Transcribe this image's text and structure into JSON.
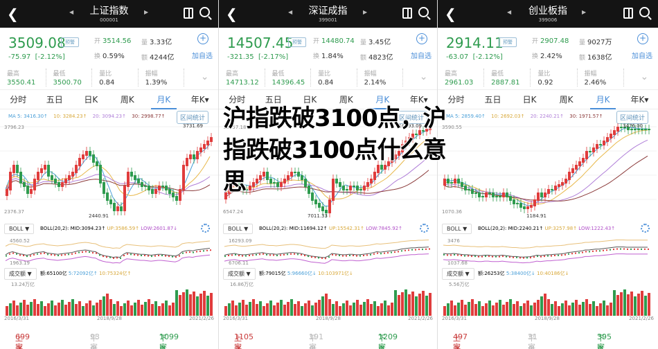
{
  "overlay_title": "沪指跌破3100点，沪指跌破3100点什么意思",
  "common": {
    "warn_label": "预警",
    "add_label": "加自选",
    "tabs": [
      "分时",
      "五日",
      "日K",
      "周K",
      "月K",
      "年K▾"
    ],
    "active_tab": "月K",
    "interval_stats": "区间统计",
    "boll_select": "BOLL ▼",
    "vol_select": "成交额 ▼",
    "label_open": "开",
    "label_vol": "量",
    "label_turnover": "换",
    "label_amount": "额",
    "label_high": "最高",
    "label_low": "最低",
    "label_ratio": "量比",
    "label_amp": "振幅",
    "up_label": "上涨",
    "flat_label": "平盘",
    "down_label": "下跌",
    "date_start": "2016/3/31",
    "date_mid": "2018/9/28",
    "date_end": "2021/2/26",
    "colors": {
      "up": "#e03c3c",
      "down": "#2e9b4e",
      "ma5": "#4a9fd8",
      "ma10": "#e8b84a",
      "ma20": "#b07fd8",
      "ma30": "#8b3a3a",
      "accent": "#4a8ed8"
    }
  },
  "panels": [
    {
      "name": "上证指数",
      "code": "000001",
      "price": "3509.08",
      "change": "-75.97",
      "change_pct": "[-2.12%]",
      "open": "3514.56",
      "volume": "3.33亿",
      "turnover": "0.59%",
      "amount": "4244亿",
      "high": "3550.41",
      "low": "3500.70",
      "vol_ratio": "0.84",
      "amplitude": "1.39%",
      "ma5": "MA 5: 3416.30↑",
      "ma10": "10: 3284.23↑",
      "ma20": "20: 3094.23↑",
      "ma30": "30: 2998.77↑",
      "y_max": "3796.23",
      "y_min": "2376.37",
      "peak": "3731.69",
      "trough": "2440.91",
      "boll": "BOLL(20,2):",
      "mid": "MID:3094.23↑",
      "up": "UP:3586.59↑",
      "low_b": "LOW:2601.87↓",
      "boll_max": "4560.52",
      "boll_min": "1963.19",
      "amt": "额:65100亿",
      "amt5": "5:72092亿↑",
      "amt10": "10:75324亿↑",
      "vol_max": "13.24万亿",
      "up_count": "699家",
      "flat_count": "93家",
      "down_count": "1099家"
    },
    {
      "name": "深证成指",
      "code": "399001",
      "price": "14507.45",
      "change": "-321.35",
      "change_pct": "[-2.17%]",
      "open": "14480.74",
      "volume": "3.45亿",
      "turnover": "1.84%",
      "amount": "4823亿",
      "high": "14713.12",
      "low": "14396.45",
      "vol_ratio": "0.84",
      "amplitude": "2.14%",
      "ma5": "",
      "ma10": "",
      "ma20": "",
      "ma30": "",
      "y_max": "16757.18",
      "y_min": "6547.24",
      "peak": "16293.09",
      "trough": "7011.33",
      "boll": "BOLL(20,2):",
      "mid": "MID:11694.12↑",
      "up": "UP:15542.31↑",
      "low_b": "LOW:7845.92↑",
      "boll_max": "16293.09",
      "boll_min": "6706.11",
      "amt": "额:79015亿",
      "amt5": "5:96660亿↓",
      "amt10": "10:103971亿↓",
      "vol_max": "16.86万亿",
      "up_count": "1105家",
      "flat_count": "191家",
      "down_count": "1209家"
    },
    {
      "name": "创业板指",
      "code": "399006",
      "price": "2914.11",
      "change": "-63.07",
      "change_pct": "[-2.12%]",
      "open": "2907.48",
      "volume": "9027万",
      "turnover": "2.42%",
      "amount": "1638亿",
      "high": "2961.03",
      "low": "2887.81",
      "vol_ratio": "0.92",
      "amplitude": "2.46%",
      "ma5": "MA 5: 2859.40↑",
      "ma10": "10: 2692.03↑",
      "ma20": "20: 2240.21↑",
      "ma30": "30: 1971.57↑",
      "y_max": "3590.55",
      "y_min": "1070.36",
      "peak": "3476.00",
      "trough": "1184.91",
      "boll": "BOLL(20,2):",
      "mid": "MID:2240.21↑",
      "up": "UP:3257.98↑",
      "low_b": "LOW:1222.43↑",
      "boll_max": "3476",
      "boll_min": "1037.68",
      "amt": "额:26253亿",
      "amt5": "5:38400亿↓",
      "amt10": "10:40186亿↓",
      "vol_max": "5.56万亿",
      "up_count": "497家",
      "flat_count": "31家",
      "down_count": "395家"
    }
  ]
}
